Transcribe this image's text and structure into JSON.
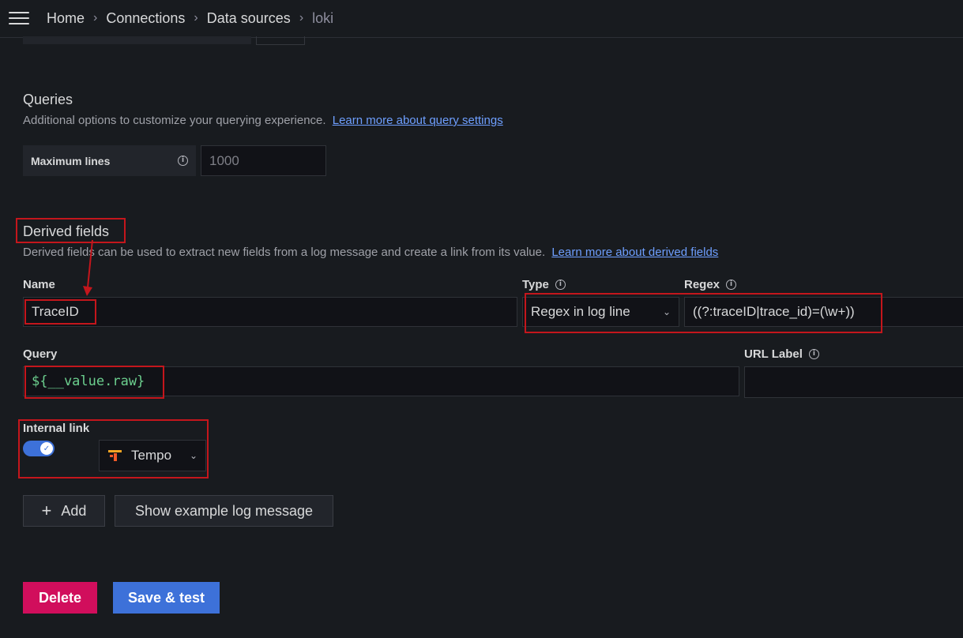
{
  "breadcrumb": [
    "Home",
    "Connections",
    "Data sources",
    "loki"
  ],
  "queries": {
    "title": "Queries",
    "description": "Additional options to customize your querying experience.",
    "link": "Learn more about query settings",
    "max_lines_label": "Maximum lines",
    "max_lines_placeholder": "1000"
  },
  "derived": {
    "title": "Derived fields",
    "description": "Derived fields can be used to extract new fields from a log message and create a link from its value.",
    "link": "Learn more about derived fields",
    "name_label": "Name",
    "name_value": "TraceID",
    "type_label": "Type",
    "type_value": "Regex in log line",
    "regex_label": "Regex",
    "regex_value": "((?:traceID|trace_id)=(\\w+))",
    "query_label": "Query",
    "query_value": "${__value.raw}",
    "url_label_label": "URL Label",
    "url_label_value": "",
    "internal_link_label": "Internal link",
    "internal_link_enabled": true,
    "datasource_value": "Tempo"
  },
  "buttons": {
    "add": "Add",
    "show_example": "Show example log message",
    "delete": "Delete",
    "save_test": "Save & test"
  },
  "colors": {
    "background": "#181b1f",
    "primary": "#3d71d9",
    "danger": "#d10e5c",
    "highlight": "#c4161c",
    "code": "#6ccf8e"
  },
  "icons": [
    "menu-icon",
    "chevron-right-icon",
    "info-icon",
    "chevron-down-icon",
    "check-icon",
    "tempo-logo-icon",
    "plus-icon"
  ]
}
